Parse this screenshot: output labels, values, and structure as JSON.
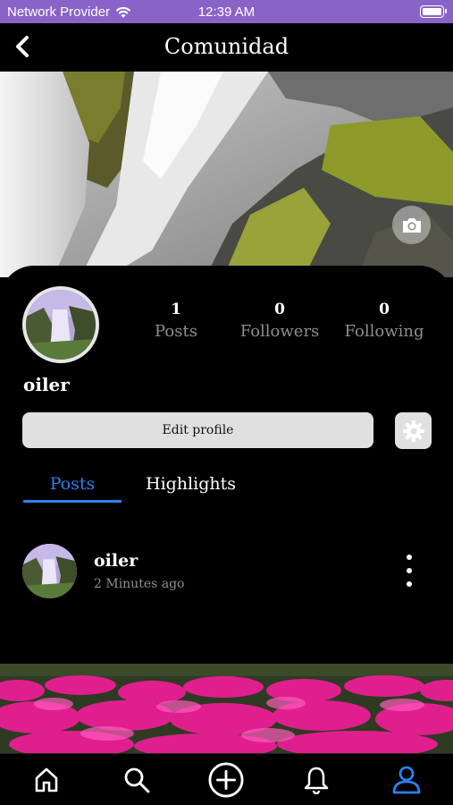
{
  "status_bar": {
    "provider": "Network Provider",
    "time": "12:39 AM"
  },
  "header": {
    "title": "Comunidad"
  },
  "profile": {
    "username": "oiler",
    "stats": [
      {
        "value": "1",
        "label": "Posts"
      },
      {
        "value": "0",
        "label": "Followers"
      },
      {
        "value": "0",
        "label": "Following"
      }
    ],
    "edit_label": "Edit profile"
  },
  "tabs": [
    {
      "label": "Posts",
      "active": true
    },
    {
      "label": "Highlights",
      "active": false
    }
  ],
  "post": {
    "username": "oiler",
    "time": "2 Minutes ago"
  },
  "colors": {
    "status_bar": "#8a63c9",
    "accent": "#2e7ff0",
    "background": "#000000"
  },
  "nav": [
    {
      "icon": "home-icon"
    },
    {
      "icon": "search-icon"
    },
    {
      "icon": "add-circle-icon"
    },
    {
      "icon": "bell-icon"
    },
    {
      "icon": "profile-icon",
      "active": true
    }
  ]
}
